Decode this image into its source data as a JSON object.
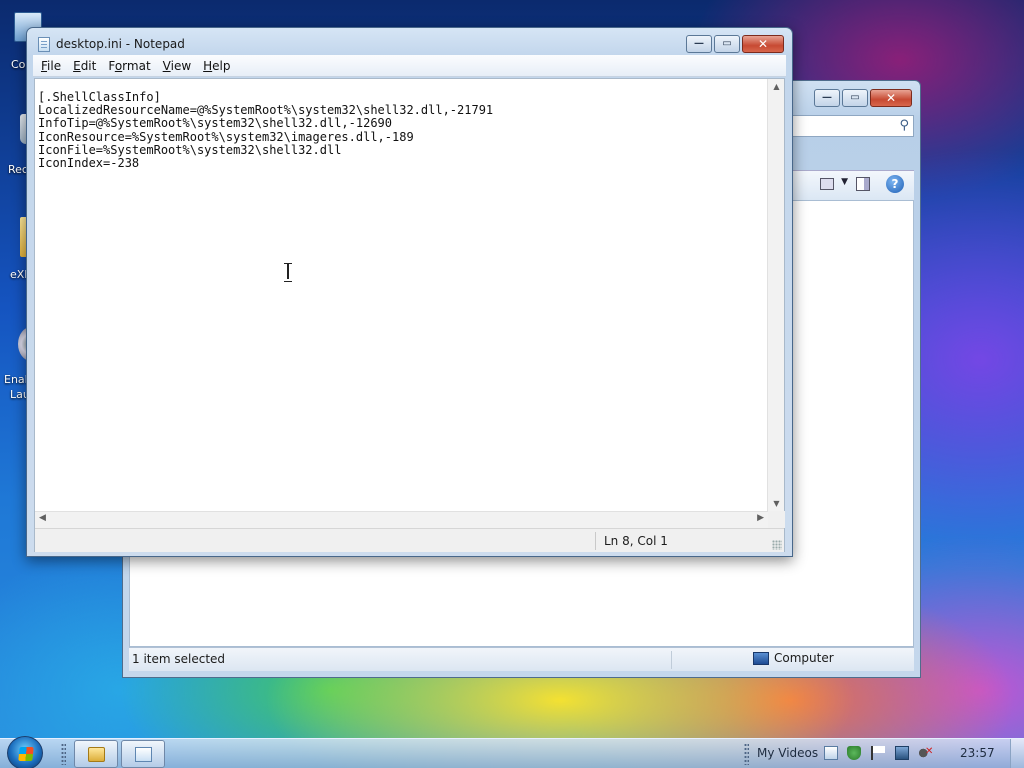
{
  "desktop": {
    "icons": [
      {
        "label": "Co",
        "icon": "computer-icon"
      },
      {
        "label": "Rec",
        "icon": "recycle-bin-icon"
      },
      {
        "label": "eXI",
        "icon": "folder-icon"
      },
      {
        "label": "Enal",
        "label2": "Lau",
        "icon": "disc-icon"
      }
    ]
  },
  "explorer": {
    "status_left": "1 item selected",
    "status_right": "Computer",
    "caption": {
      "minimize": "—",
      "maximize": "▭",
      "close": "✕"
    },
    "help_glyph": "?",
    "search_glyph": "⚲"
  },
  "notepad": {
    "title": "desktop.ini - Notepad",
    "menu": [
      {
        "key": "F",
        "rest": "ile"
      },
      {
        "key": "E",
        "rest": "dit"
      },
      {
        "key": "F",
        "rest": "ormat",
        "prefix": ""
      },
      {
        "key": "V",
        "rest": "iew"
      },
      {
        "key": "H",
        "rest": "elp"
      }
    ],
    "content": "[.ShellClassInfo]\nLocalizedResourceName=@%SystemRoot%\\system32\\shell32.dll,-21791\nInfoTip=@%SystemRoot%\\system32\\shell32.dll,-12690\nIconResource=%SystemRoot%\\system32\\imageres.dll,-189\nIconFile=%SystemRoot%\\system32\\shell32.dll\nIconIndex=-238",
    "status_position": "Ln 8, Col 1",
    "caption": {
      "minimize": "—",
      "maximize": "▭",
      "close": "✕"
    }
  },
  "taskbar": {
    "tray_label": "My Videos",
    "clock": "23:57"
  }
}
